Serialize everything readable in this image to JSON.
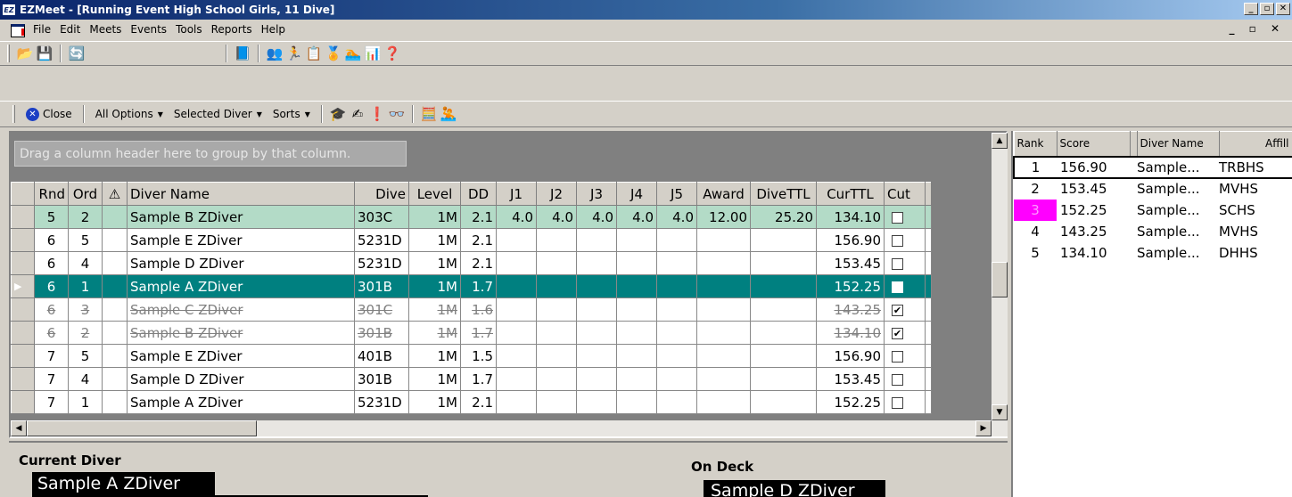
{
  "window": {
    "title": "EZMeet - [Running Event High School Girls, 11 Dive]",
    "app_icon": "EZ"
  },
  "menu": {
    "items": [
      "File",
      "Edit",
      "Meets",
      "Events",
      "Tools",
      "Reports",
      "Help"
    ]
  },
  "toolbar2": {
    "close_label": "Close",
    "all_options": "All Options",
    "selected_diver": "Selected Diver",
    "sorts": "Sorts"
  },
  "grid": {
    "group_hint": "Drag a column header here to group by that column.",
    "headers": [
      "Rnd",
      "Ord",
      "",
      "Diver Name",
      "Dive",
      "Level",
      "DD",
      "J1",
      "J2",
      "J3",
      "J4",
      "J5",
      "Award",
      "DiveTTL",
      "CurTTL",
      "Cut"
    ],
    "rows": [
      {
        "state": "green",
        "rnd": "5",
        "ord": "2",
        "name": "Sample B ZDiver",
        "dive": "303C",
        "level": "1M",
        "dd": "2.1",
        "j1": "4.0",
        "j2": "4.0",
        "j3": "4.0",
        "j4": "4.0",
        "j5": "4.0",
        "award": "12.00",
        "divettl": "25.20",
        "curttl": "134.10",
        "cut": false
      },
      {
        "state": "normal",
        "rnd": "6",
        "ord": "5",
        "name": "Sample E ZDiver",
        "dive": "5231D",
        "level": "1M",
        "dd": "2.1",
        "j1": "",
        "j2": "",
        "j3": "",
        "j4": "",
        "j5": "",
        "award": "",
        "divettl": "",
        "curttl": "156.90",
        "cut": false
      },
      {
        "state": "normal",
        "rnd": "6",
        "ord": "4",
        "name": "Sample D ZDiver",
        "dive": "5231D",
        "level": "1M",
        "dd": "2.1",
        "j1": "",
        "j2": "",
        "j3": "",
        "j4": "",
        "j5": "",
        "award": "",
        "divettl": "",
        "curttl": "153.45",
        "cut": false
      },
      {
        "state": "teal",
        "rnd": "6",
        "ord": "1",
        "name": "Sample A ZDiver",
        "dive": "301B",
        "level": "1M",
        "dd": "1.7",
        "j1": "",
        "j2": "",
        "j3": "",
        "j4": "",
        "j5": "",
        "award": "",
        "divettl": "",
        "curttl": "152.25",
        "cut": false
      },
      {
        "state": "strike",
        "rnd": "6",
        "ord": "3",
        "name": "Sample C ZDiver",
        "dive": "301C",
        "level": "1M",
        "dd": "1.6",
        "j1": "",
        "j2": "",
        "j3": "",
        "j4": "",
        "j5": "",
        "award": "",
        "divettl": "",
        "curttl": "143.25",
        "cut": true
      },
      {
        "state": "strike",
        "rnd": "6",
        "ord": "2",
        "name": "Sample B ZDiver",
        "dive": "301B",
        "level": "1M",
        "dd": "1.7",
        "j1": "",
        "j2": "",
        "j3": "",
        "j4": "",
        "j5": "",
        "award": "",
        "divettl": "",
        "curttl": "134.10",
        "cut": true
      },
      {
        "state": "normal",
        "rnd": "7",
        "ord": "5",
        "name": "Sample E ZDiver",
        "dive": "401B",
        "level": "1M",
        "dd": "1.5",
        "j1": "",
        "j2": "",
        "j3": "",
        "j4": "",
        "j5": "",
        "award": "",
        "divettl": "",
        "curttl": "156.90",
        "cut": false
      },
      {
        "state": "normal",
        "rnd": "7",
        "ord": "4",
        "name": "Sample D ZDiver",
        "dive": "301B",
        "level": "1M",
        "dd": "1.7",
        "j1": "",
        "j2": "",
        "j3": "",
        "j4": "",
        "j5": "",
        "award": "",
        "divettl": "",
        "curttl": "153.45",
        "cut": false
      },
      {
        "state": "normal",
        "rnd": "7",
        "ord": "1",
        "name": "Sample A ZDiver",
        "dive": "5231D",
        "level": "1M",
        "dd": "2.1",
        "j1": "",
        "j2": "",
        "j3": "",
        "j4": "",
        "j5": "",
        "award": "",
        "divettl": "",
        "curttl": "152.25",
        "cut": false
      }
    ]
  },
  "current": {
    "label": "Current Diver",
    "name": "Sample A ZDiver"
  },
  "ondeck": {
    "label": "On Deck",
    "name": "Sample D ZDiver"
  },
  "ranking": {
    "headers": [
      "Rank",
      "Score",
      "",
      "Diver Name",
      "Affill"
    ],
    "rows": [
      {
        "rank": "1",
        "score": "156.90",
        "name": "Sample...",
        "affil": "TRBHS"
      },
      {
        "rank": "2",
        "score": "153.45",
        "name": "Sample...",
        "affil": "MVHS"
      },
      {
        "rank": "3",
        "score": "152.25",
        "name": "Sample...",
        "affil": "SCHS",
        "highlight": "#ff00ff"
      },
      {
        "rank": "4",
        "score": "143.25",
        "name": "Sample...",
        "affil": "MVHS"
      },
      {
        "rank": "5",
        "score": "134.10",
        "name": "Sample...",
        "affil": "DHHS"
      }
    ]
  }
}
